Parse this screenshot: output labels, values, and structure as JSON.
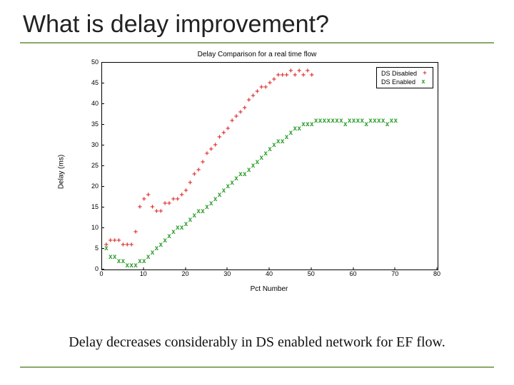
{
  "slide": {
    "title": "What is delay improvement?",
    "caption": "Delay decreases considerably in DS enabled network for EF flow."
  },
  "chart_data": {
    "type": "scatter",
    "title": "Delay Comparison for a real time flow",
    "xlabel": "Pct Number",
    "ylabel": "Delay (ms)",
    "xlim": [
      0,
      80
    ],
    "ylim": [
      0,
      50
    ],
    "xticks": [
      0,
      10,
      20,
      30,
      40,
      50,
      60,
      70,
      80
    ],
    "yticks": [
      0,
      5,
      10,
      15,
      20,
      25,
      30,
      35,
      40,
      45,
      50
    ],
    "grid": false,
    "legend_position": "top-right",
    "series": [
      {
        "name": "DS Disabled",
        "marker": "+",
        "color": "#e03030",
        "x": [
          1,
          2,
          3,
          4,
          5,
          6,
          7,
          8,
          9,
          10,
          11,
          12,
          13,
          14,
          15,
          16,
          17,
          18,
          19,
          20,
          21,
          22,
          23,
          24,
          25,
          26,
          27,
          28,
          29,
          30,
          31,
          32,
          33,
          34,
          35,
          36,
          37,
          38,
          39,
          40,
          41,
          42,
          43,
          44,
          45,
          46,
          47,
          48,
          49,
          50
        ],
        "y": [
          6,
          7,
          7,
          7,
          6,
          6,
          6,
          9,
          15,
          17,
          18,
          15,
          14,
          14,
          16,
          16,
          17,
          17,
          18,
          19,
          21,
          23,
          24,
          26,
          28,
          29,
          30,
          32,
          33,
          34,
          36,
          37,
          38,
          39,
          41,
          42,
          43,
          44,
          44,
          45,
          46,
          47,
          47,
          47,
          48,
          47,
          48,
          47,
          48,
          47
        ]
      },
      {
        "name": "DS Enabled",
        "marker": "x",
        "color": "#30a030",
        "x": [
          1,
          2,
          3,
          4,
          5,
          6,
          7,
          8,
          9,
          10,
          11,
          12,
          13,
          14,
          15,
          16,
          17,
          18,
          19,
          20,
          21,
          22,
          23,
          24,
          25,
          26,
          27,
          28,
          29,
          30,
          31,
          32,
          33,
          34,
          35,
          36,
          37,
          38,
          39,
          40,
          41,
          42,
          43,
          44,
          45,
          46,
          47,
          48,
          49,
          50,
          51,
          52,
          53,
          54,
          55,
          56,
          57,
          58,
          59,
          60,
          61,
          62,
          63,
          64,
          65,
          66,
          67,
          68,
          69,
          70
        ],
        "y": [
          5,
          3,
          3,
          2,
          2,
          1,
          1,
          1,
          2,
          2,
          3,
          4,
          5,
          6,
          7,
          8,
          9,
          10,
          10,
          11,
          12,
          13,
          14,
          14,
          15,
          16,
          17,
          18,
          19,
          20,
          21,
          22,
          23,
          23,
          24,
          25,
          26,
          27,
          28,
          29,
          30,
          31,
          31,
          32,
          33,
          34,
          34,
          35,
          35,
          35,
          36,
          36,
          36,
          36,
          36,
          36,
          36,
          35,
          36,
          36,
          36,
          36,
          35,
          36,
          36,
          36,
          36,
          35,
          36,
          36
        ]
      }
    ]
  }
}
